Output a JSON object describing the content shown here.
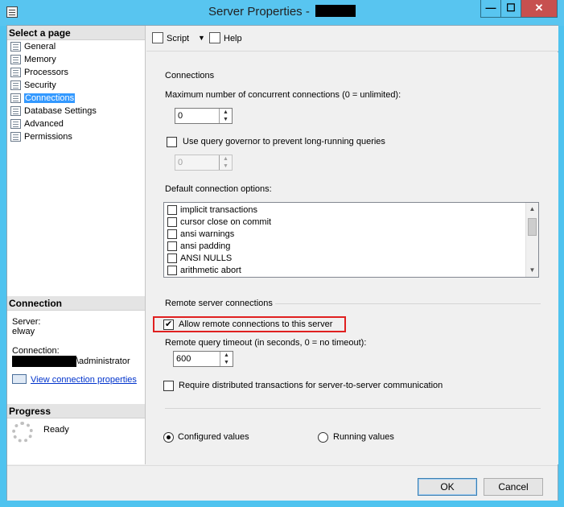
{
  "window": {
    "title": "Server Properties - ",
    "minimize": "—",
    "maximize": "☐",
    "close": "✕"
  },
  "left": {
    "select_page_header": "Select a page",
    "pages": [
      "General",
      "Memory",
      "Processors",
      "Security",
      "Connections",
      "Database Settings",
      "Advanced",
      "Permissions"
    ],
    "selected_page": "Connections",
    "connection_header": "Connection",
    "server_label": "Server:",
    "server_value": "elway",
    "connection_label": "Connection:",
    "connection_value": "\\administrator",
    "view_connection_link": "View connection properties",
    "progress_header": "Progress",
    "progress_status": "Ready"
  },
  "toolbar": {
    "script_label": "Script",
    "help_label": "Help"
  },
  "connections": {
    "group_label": "Connections",
    "max_connections_label": "Maximum number of concurrent connections (0 = unlimited):",
    "max_connections_value": "0",
    "query_governor_label": "Use query governor to prevent long-running queries",
    "query_governor_checked": false,
    "query_governor_value": "0",
    "default_options_label": "Default connection options:",
    "options": [
      {
        "label": "implicit transactions",
        "checked": false
      },
      {
        "label": "cursor close on commit",
        "checked": false
      },
      {
        "label": "ansi warnings",
        "checked": false
      },
      {
        "label": "ansi padding",
        "checked": false
      },
      {
        "label": "ANSI NULLS",
        "checked": false
      },
      {
        "label": "arithmetic abort",
        "checked": false
      }
    ]
  },
  "remote": {
    "group_label": "Remote server connections",
    "allow_remote_label": "Allow remote connections to this server",
    "allow_remote_checked": true,
    "timeout_label": "Remote query timeout (in seconds, 0 = no timeout):",
    "timeout_value": "600",
    "distributed_label": "Require distributed transactions for server-to-server communication",
    "distributed_checked": false
  },
  "values_mode": {
    "configured_label": "Configured values",
    "running_label": "Running values",
    "selected": "configured"
  },
  "footer": {
    "ok_label": "OK",
    "cancel_label": "Cancel"
  },
  "colors": {
    "title_bar": "#58c5f0",
    "selection": "#3399ff",
    "highlight_box": "#e02020",
    "close_button": "#c7504f"
  }
}
